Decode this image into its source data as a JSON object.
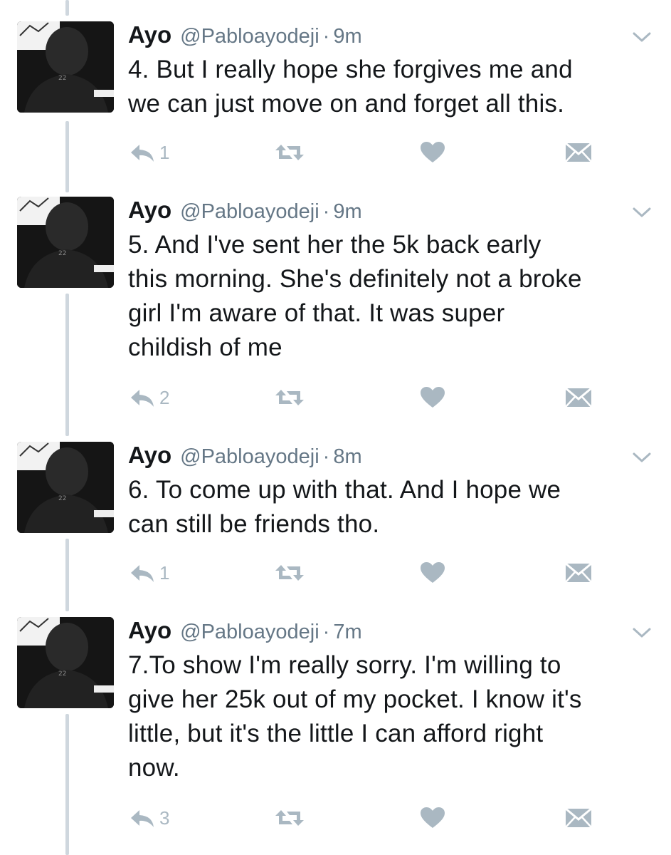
{
  "colors": {
    "icon_gray": "#aab8c2",
    "meta_gray": "#657786",
    "text_dark": "#14171a",
    "thread_line": "#cfd7de"
  },
  "tweets": [
    {
      "name": "Ayo",
      "handle": "@Pabloayodeji",
      "separator": "·",
      "time": "9m",
      "lines": [
        "4. But I really hope she forgives me and",
        "we can just move on and forget all this."
      ],
      "reply_count": "1"
    },
    {
      "name": "Ayo",
      "handle": "@Pabloayodeji",
      "separator": "·",
      "time": "9m",
      "lines": [
        "5. And I've sent her the 5k back early",
        "this morning. She's definitely not a broke",
        "girl I'm aware of that. It was super",
        "childish of me"
      ],
      "reply_count": "2"
    },
    {
      "name": "Ayo",
      "handle": "@Pabloayodeji",
      "separator": "·",
      "time": "8m",
      "lines": [
        "6. To come up with that. And I hope we",
        "can still be friends tho."
      ],
      "reply_count": "1"
    },
    {
      "name": "Ayo",
      "handle": "@Pabloayodeji",
      "separator": "·",
      "time": "7m",
      "lines": [
        "7.To show I'm really sorry. I'm willing to",
        "give her 25k out of my pocket. I know it's",
        "little, but it's the little I can afford right",
        "now."
      ],
      "reply_count": "3"
    }
  ],
  "icons": {
    "avatar": "avatar-photo",
    "caret": "chevron-down-icon",
    "reply": "reply-icon",
    "retweet": "retweet-icon",
    "like": "heart-icon",
    "dm": "direct-message-icon"
  }
}
